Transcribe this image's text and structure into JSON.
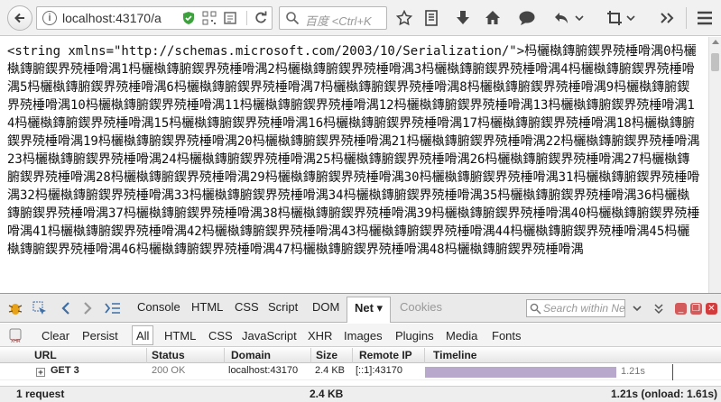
{
  "browser": {
    "url": "localhost:43170/a",
    "search_placeholder": "百度 <Ctrl+K",
    "icons": [
      "back-icon",
      "info-icon",
      "shield-icon",
      "qr-icon",
      "reader-icon",
      "reload-icon",
      "search-icon",
      "star-icon",
      "bookmarks-icon",
      "download-icon",
      "home-icon",
      "chat-icon",
      "undo-icon",
      "crop-icon",
      "overflow-icon",
      "menu-icon"
    ]
  },
  "page": {
    "xml_prefix": "<string xmlns=\"http://schemas.microsoft.com/2003/10/Serialization/\">",
    "xml_body": "杩欐槸鏄腑鍥界殑棰嗗湡0杩欐槸鏄腑鍥界殑棰嗗湡1杩欐槸鏄腑鍥界殑棰嗗湡2杩欐槸鏄腑鍥界殑棰嗗湡3杩欐槸鏄腑鍥界殑棰嗗湡4杩欐槸鏄腑鍥界殑棰嗗湡5杩欐槸鏄腑鍥界殑棰嗗湡6杩欐槸鏄腑鍥界殑棰嗗湡7杩欐槸鏄腑鍥界殑棰嗗湡8杩欐槸鏄腑鍥界殑棰嗗湡9杩欐槸鏄腑鍥界殑棰嗗湡10杩欐槸鏄腑鍥界殑棰嗗湡11杩欐槸鏄腑鍥界殑棰嗗湡12杩欐槸鏄腑鍥界殑棰嗗湡13杩欐槸鏄腑鍥界殑棰嗗湡14杩欐槸鏄腑鍥界殑棰嗗湡15杩欐槸鏄腑鍥界殑棰嗗湡16杩欐槸鏄腑鍥界殑棰嗗湡17杩欐槸鏄腑鍥界殑棰嗗湡18杩欐槸鏄腑鍥界殑棰嗗湡19杩欐槸鏄腑鍥界殑棰嗗湡20杩欐槸鏄腑鍥界殑棰嗗湡21杩欐槸鏄腑鍥界殑棰嗗湡22杩欐槸鏄腑鍥界殑棰嗗湡23杩欐槸鏄腑鍥界殑棰嗗湡24杩欐槸鏄腑鍥界殑棰嗗湡25杩欐槸鏄腑鍥界殑棰嗗湡26杩欐槸鏄腑鍥界殑棰嗗湡27杩欐槸鏄腑鍥界殑棰嗗湡28杩欐槸鏄腑鍥界殑棰嗗湡29杩欐槸鏄腑鍥界殑棰嗗湡30杩欐槸鏄腑鍥界殑棰嗗湡31杩欐槸鏄腑鍥界殑棰嗗湡32杩欐槸鏄腑鍥界殑棰嗗湡33杩欐槸鏄腑鍥界殑棰嗗湡34杩欐槸鏄腑鍥界殑棰嗗湡35杩欐槸鏄腑鍥界殑棰嗗湡36杩欐槸鏄腑鍥界殑棰嗗湡37杩欐槸鏄腑鍥界殑棰嗗湡38杩欐槸鏄腑鍥界殑棰嗗湡39杩欐槸鏄腑鍥界殑棰嗗湡40杩欐槸鏄腑鍥界殑棰嗗湡41杩欐槸鏄腑鍥界殑棰嗗湡42杩欐槸鏄腑鍥界殑棰嗗湡43杩欐槸鏄腑鍥界殑棰嗗湡44杩欐槸鏄腑鍥界殑棰嗗湡45杩欐槸鏄腑鍥界殑棰嗗湡46杩欐槸鏄腑鍥界殑棰嗗湡47杩欐槸鏄腑鍥界殑棰嗗湡48杩欐槸鏄腑鍥界殑棰嗗湡"
  },
  "firebug": {
    "tabs": [
      "Console",
      "HTML",
      "CSS",
      "Script",
      "DOM",
      "Net ▾",
      "Cookies"
    ],
    "active_tab": "Net ▾",
    "search_placeholder": "Search within Ne",
    "filters": [
      "Clear",
      "Persist",
      "All",
      "HTML",
      "CSS",
      "JavaScript",
      "XHR",
      "Images",
      "Plugins",
      "Media",
      "Fonts"
    ],
    "active_filter": "All",
    "columns": [
      "URL",
      "Status",
      "Domain",
      "Size",
      "Remote IP",
      "Timeline"
    ],
    "request": {
      "url": "GET 3",
      "status": "200 OK",
      "domain": "localhost:43170",
      "size": "2.4 KB",
      "remote_ip": "[::1]:43170",
      "timeline_label": "1.21s"
    },
    "footer": {
      "count": "1 request",
      "total_size": "2.4 KB",
      "timing": "1.21s (onload: 1.61s)"
    }
  }
}
